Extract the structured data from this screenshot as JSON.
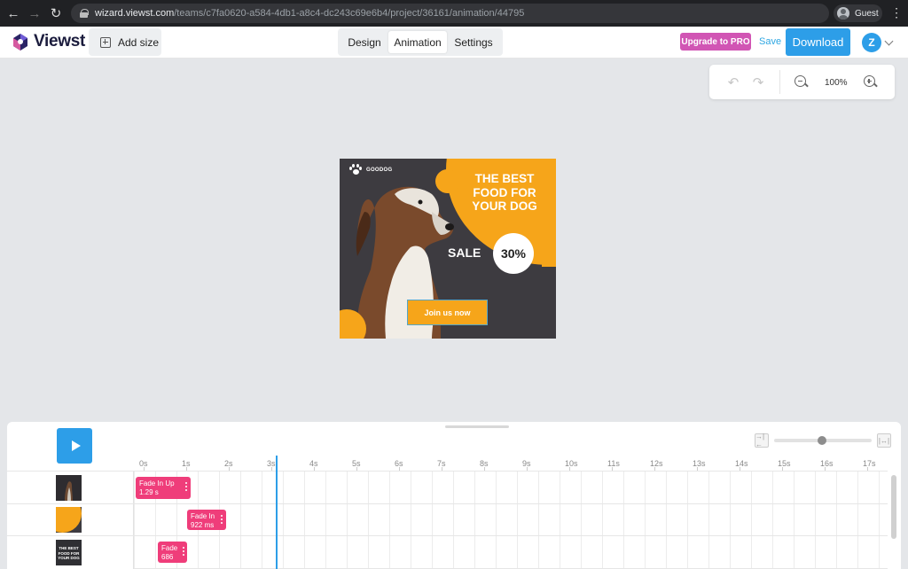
{
  "browser": {
    "url_host": "wizard.viewst.com",
    "url_path": "/teams/c7fa0620-a584-4db1-a8c4-dc243c69e6b4/project/36161/animation/44795",
    "profile_name": "Guest"
  },
  "header": {
    "logo_text": "Viewst",
    "add_size_label": "Add size",
    "tabs": [
      {
        "label": "Design",
        "active": false
      },
      {
        "label": "Animation",
        "active": true
      },
      {
        "label": "Settings",
        "active": false
      }
    ],
    "upgrade_label": "Upgrade to PRO",
    "save_label": "Save",
    "download_label": "Download",
    "user_initial": "Z",
    "accent_color": "#2d9ee8",
    "upgrade_color": "#d155b4"
  },
  "zoom": {
    "level": "100%",
    "icons": [
      "undo-icon",
      "redo-icon",
      "zoom-out-icon",
      "zoom-in-icon"
    ]
  },
  "banner": {
    "brand": "GOODOG",
    "headline_1": "THE BEST",
    "headline_2": "FOOD FOR",
    "headline_3": "YOUR DOG",
    "sale": "SALE",
    "discount": "30%",
    "cta": "Join us now",
    "accent_color": "#f6a51a",
    "background_color": "#3d3b40"
  },
  "timeline": {
    "ticks": [
      "0s",
      "1s",
      "2s",
      "3s",
      "4s",
      "5s",
      "6s",
      "7s",
      "8s",
      "9s",
      "10s",
      "11s",
      "12s",
      "13s",
      "14s",
      "15s",
      "16s",
      "17s"
    ],
    "layers": [
      {
        "thumb": "dog-photo",
        "animation": {
          "name": "Fade In Up",
          "duration": "1.29 s"
        }
      },
      {
        "thumb": "orange-shape",
        "animation": {
          "name": "Fade In",
          "duration": "922 ms"
        }
      },
      {
        "thumb": "headline-text",
        "thumb_lines": [
          "THE BEST",
          "FOOD FOR",
          "YOUR DOG"
        ],
        "animation": {
          "name": "Fade",
          "duration": "686"
        }
      }
    ],
    "block_color": "#ef3d7a"
  }
}
